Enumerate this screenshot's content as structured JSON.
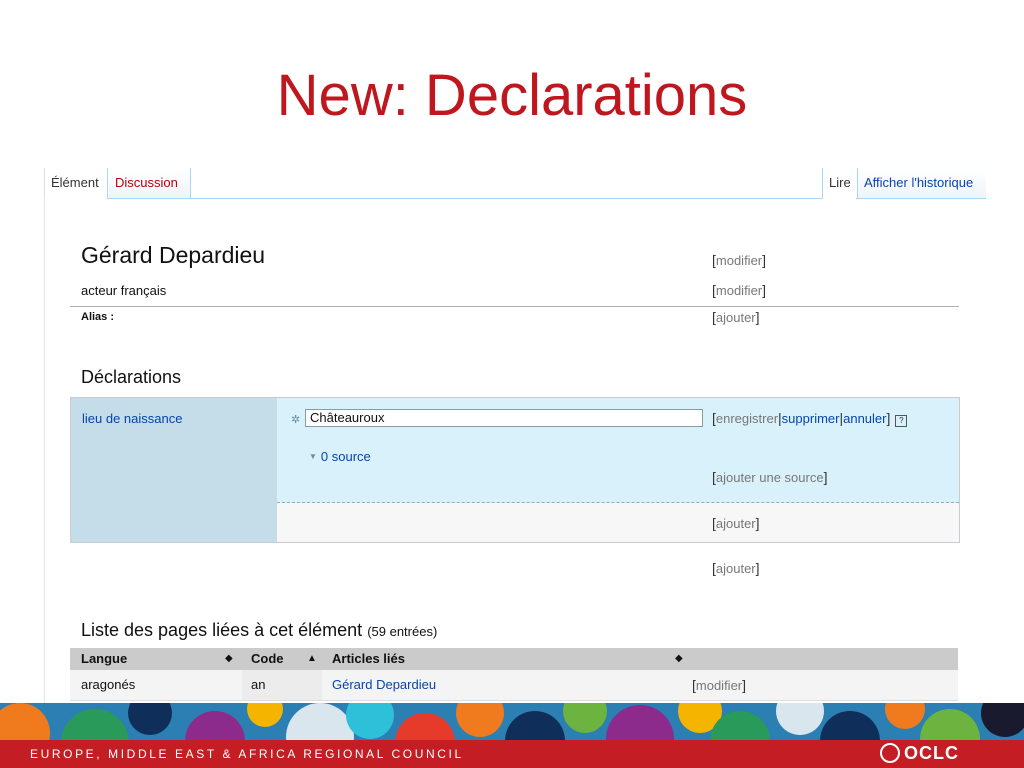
{
  "slide": {
    "title": "New: Declarations"
  },
  "tabs": {
    "element": "Élément",
    "discussion": "Discussion",
    "read": "Lire",
    "history": "Afficher l'historique"
  },
  "entity": {
    "label": "Gérard Depardieu",
    "description": "acteur français",
    "alias_label": "Alias :",
    "edit": "modifier",
    "add": "ajouter"
  },
  "statements": {
    "heading": "Déclarations",
    "property": "lieu de naissance",
    "value": "Châteauroux",
    "sources": "0 source",
    "save": "enregistrer",
    "remove": "supprimer",
    "cancel": "annuler",
    "help": "?",
    "add_source": "ajouter une source",
    "add": "ajouter"
  },
  "sitelinks": {
    "heading": "Liste des pages liées à cet élément",
    "count": "(59 entrées)",
    "columns": [
      "Langue",
      "Code",
      "Articles liés"
    ],
    "rows": [
      {
        "language": "aragonés",
        "code": "an",
        "article": "Gérard Depardieu",
        "edit": "modifier"
      }
    ]
  },
  "footer": {
    "text": "EUROPE, MIDDLE EAST & AFRICA REGIONAL COUNCIL",
    "logo": "OCLC"
  },
  "colors": {
    "title_red": "#c0161e",
    "link_blue": "#0645ad",
    "footer_red": "#c41e24"
  }
}
